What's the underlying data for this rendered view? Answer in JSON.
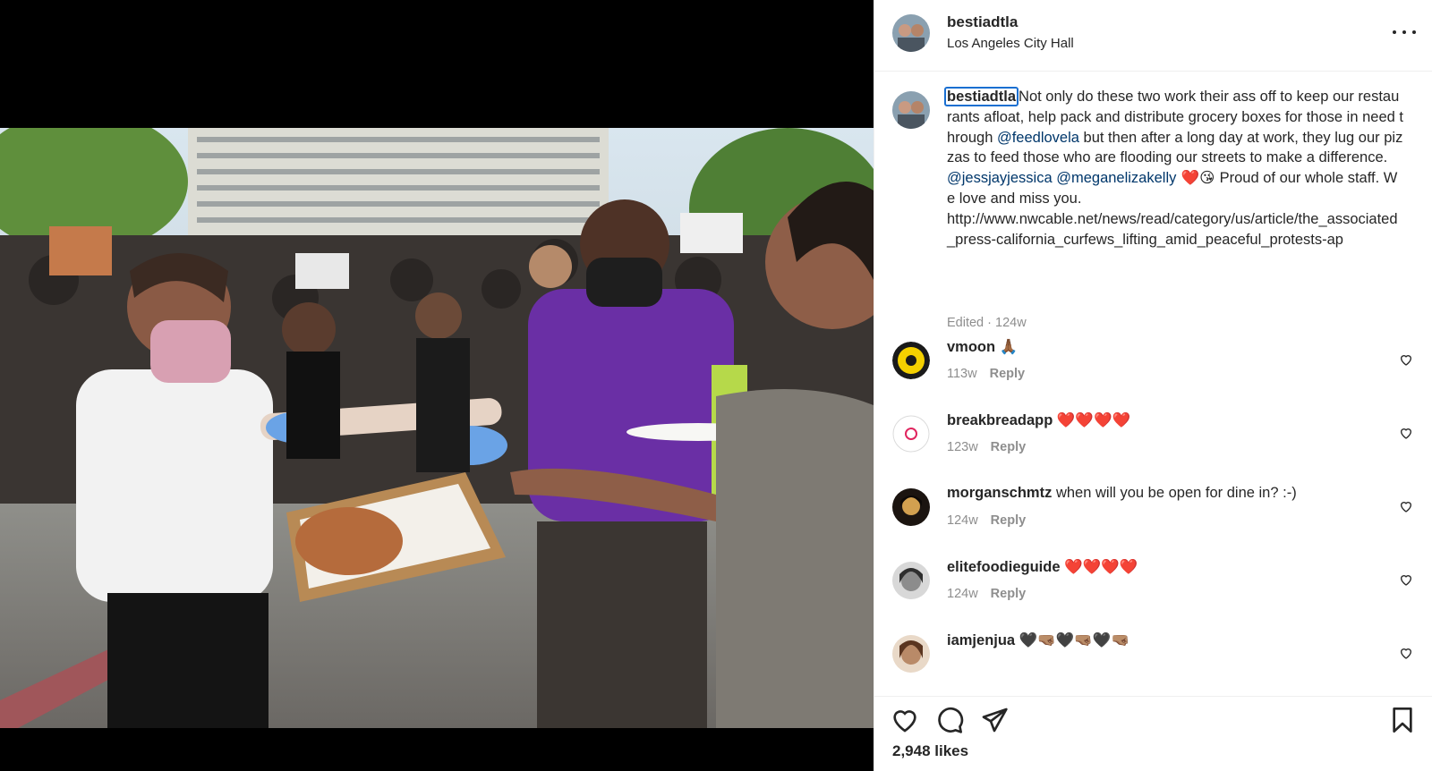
{
  "post": {
    "username": "bestiadtla",
    "location": "Los Angeles City Hall",
    "caption": {
      "username": "bestiadtla",
      "text_1": "Not only do these two work their ass off to keep our restaurants afloat, help pack and distribute grocery boxes for those in need through ",
      "mention_1": "@feedlovela",
      "text_2": " but then after a long day at work, they lug our pizzas to feed those who are flooding our streets to make a difference. ",
      "mention_2": "@jessjayjessica",
      "mention_3": "@meganelizakelly",
      "emojis": " ❤️😘 ",
      "text_3": "Proud of our whole staff. We love and miss you.",
      "url": "http://www.nwcable.net/news/read/category/us/article/the_associated_press-california_curfews_lifting_amid_peaceful_protests-ap",
      "meta": "Edited · 124w"
    },
    "likes": "2,948 likes"
  },
  "comments": [
    {
      "username": "vmoon",
      "text": "🙏🏾",
      "age": "113w",
      "reply": "Reply",
      "avatar": "stand-with-production-logo"
    },
    {
      "username": "breakbreadapp",
      "text": "❤️❤️❤️❤️",
      "age": "123w",
      "reply": "Reply",
      "avatar": "breakbread-logo"
    },
    {
      "username": "morganschmtz",
      "text": "when will you be open for dine in? :-)",
      "age": "124w",
      "reply": "Reply",
      "avatar": "person-photo"
    },
    {
      "username": "elitefoodieguide",
      "text": "❤️❤️❤️❤️",
      "age": "124w",
      "reply": "Reply",
      "avatar": "person-photo"
    },
    {
      "username": "iamjenjua",
      "text": "🖤🤜🏽🖤🤜🏽🖤🤜🏽",
      "age": "",
      "reply": "",
      "avatar": "person-photo"
    }
  ],
  "icons": {
    "more": "more-options-icon",
    "like": "heart-outline-icon",
    "comment": "speech-bubble-icon",
    "share": "paper-plane-icon",
    "save": "bookmark-icon"
  },
  "colors": {
    "accent_link": "#00376b",
    "muted": "#8e8e8e",
    "focus_ring": "#1a6fd1"
  }
}
